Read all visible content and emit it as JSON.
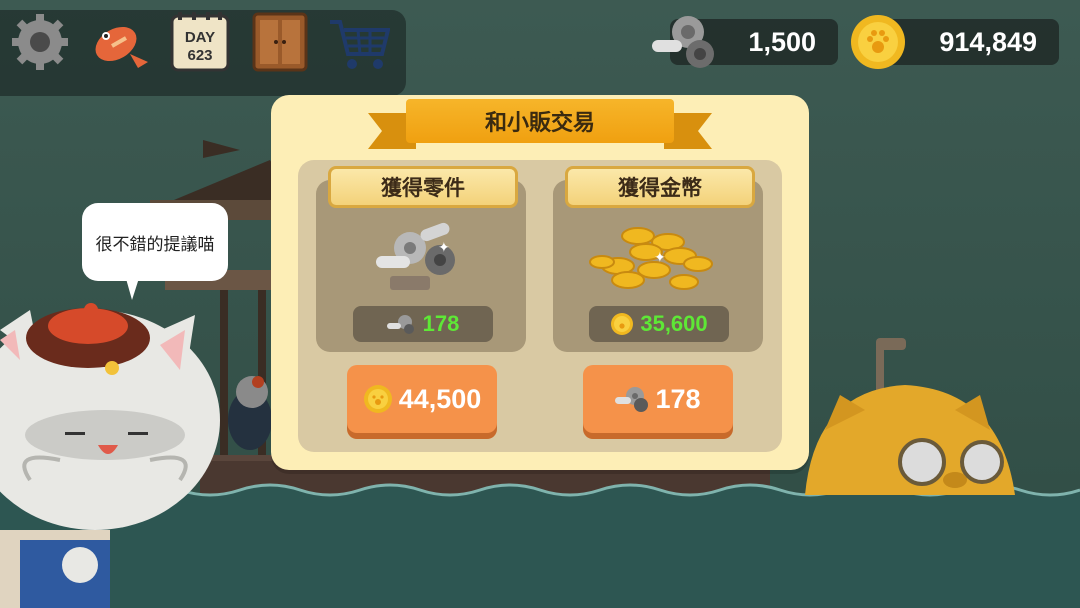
{
  "toolbar": {
    "icons": [
      "settings-gear-icon",
      "fish-icon",
      "calendar-day-icon",
      "door-icon",
      "cart-icon"
    ],
    "day_label": "DAY",
    "day_number": "623"
  },
  "currencies": {
    "parts": {
      "icon": "gears-parts-icon",
      "value": "1,500"
    },
    "coins": {
      "icon": "paw-coin-icon",
      "value": "914,849"
    }
  },
  "dialog": {
    "title": "和小販交易",
    "options": [
      {
        "title": "獲得零件",
        "image": "gears-pile-icon",
        "receive_value": "178",
        "receive_icon": "gears-parts-icon",
        "cost_value": "44,500",
        "cost_icon": "paw-coin-icon"
      },
      {
        "title": "獲得金幣",
        "image": "coin-pile-icon",
        "receive_value": "35,600",
        "receive_icon": "paw-coin-icon",
        "cost_value": "178",
        "cost_icon": "gears-parts-icon"
      }
    ]
  },
  "npc": {
    "speech": "很不錯的提議喵"
  },
  "colors": {
    "modal_bg": "#fdeeb6",
    "ribbon": "#f0a010",
    "button": "#f5924a",
    "reward_text": "#5ee836"
  }
}
